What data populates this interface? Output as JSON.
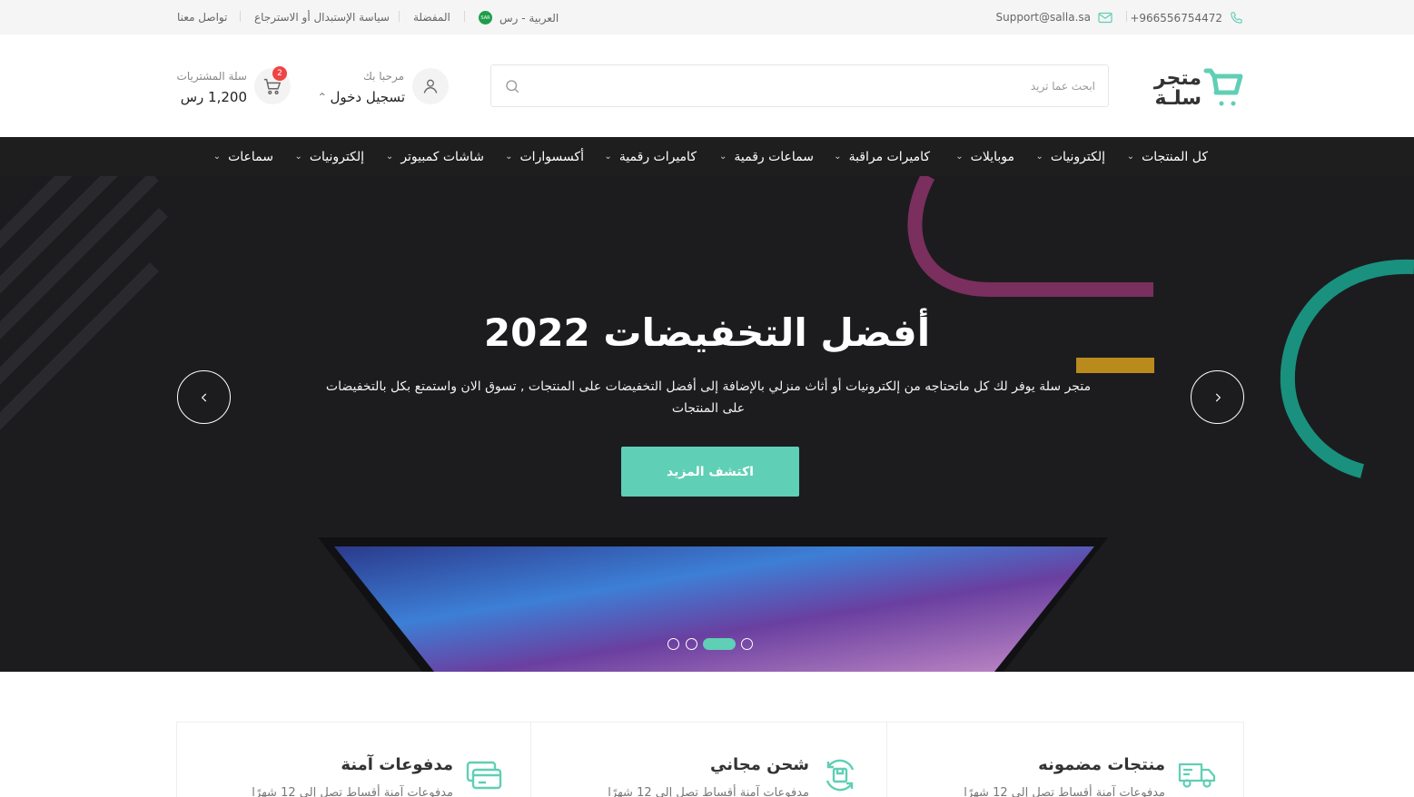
{
  "topbar": {
    "phone": "+966556754472",
    "email": "Support@salla.sa",
    "language": "العربية - رس",
    "flag_text": "SAR",
    "favorites": "المفضلة",
    "policy": "سياسة الإستبدال أو الاسترجاع",
    "contact": "تواصل معنا"
  },
  "header": {
    "logo_line1": "متجر",
    "logo_line2": "سلـة",
    "search_placeholder": "ابحث عما تريد",
    "greeting": "مرحبا بك",
    "login_label": "تسجيل دخول",
    "cart_label": "سلة المشتريات",
    "cart_total": "1,200 رس",
    "cart_count": "2"
  },
  "nav": {
    "items": [
      {
        "label": "كل المنتجات"
      },
      {
        "label": "إلكترونيات"
      },
      {
        "label": "موبايلات"
      },
      {
        "label": "كاميرات مراقبة"
      },
      {
        "label": "سماعات رقمية"
      },
      {
        "label": "كاميرات رقمية"
      },
      {
        "label": "أكسسوارات"
      },
      {
        "label": "شاشات كمبيوتر"
      },
      {
        "label": "إلكترونيات"
      },
      {
        "label": "سماعات"
      }
    ]
  },
  "hero": {
    "title": "أفضل التخفيضات 2022",
    "subtitle": "متجر سلة يوفر لك كل ماتحتاجه من إلكترونيات أو أثاث منزلي بالإضافة إلى أفضل التخفيضات على المنتجات , تسوق الان واستمتع بكل بالتخفيضات على المنتجات",
    "cta": "اكتشف المزيد",
    "slide_count": 4,
    "active_slide": 2
  },
  "features": [
    {
      "title": "منتجات مضمونه",
      "desc": "مدفوعات آمنة أقساط تصل إلى 12 شهرًا",
      "icon": "truck-icon"
    },
    {
      "title": "شحن مجاني",
      "desc": "مدفوعات آمنة أقساط تصل إلى 12 شهرًا",
      "icon": "box-refresh-icon"
    },
    {
      "title": "مدفوعات آمنة",
      "desc": "مدفوعات آمنة أقساط تصل إلى 12 شهرًا",
      "icon": "credit-card-icon"
    }
  ],
  "colors": {
    "accent": "#5fcfb5",
    "nav_bg": "#1e1e1e",
    "hero_bg": "#1c1c1f",
    "badge": "#ef4444"
  }
}
